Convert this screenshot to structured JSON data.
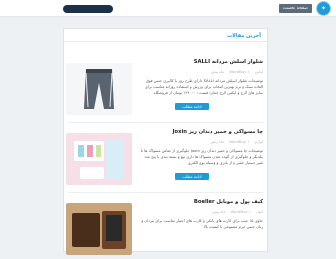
{
  "header": {
    "home_label": "صفحه نخست",
    "colors": {
      "accent": "#1f9bd6",
      "topbar": "#ffffff",
      "search": "#1a3147",
      "button": "#5c6a7a"
    }
  },
  "main": {
    "section_title": "آخرین مقالات",
    "posts": [
      {
        "title": "شلوار اسلش مردانه SALLI",
        "category": "لباس",
        "author": "WordBuy",
        "date": "۱ ماه پیش",
        "excerpt": "توضیحات شلوار اسلش مردانه SALLI دارای طرح روز با کالیری جنس فوق العاده سبک و نرم بهترین انتخاب برای ورزش و استفاده روزانه مناسب برای سایز های لارج و ایکس لارج (مثل)",
        "price": "قیمت : ۱۲۹۰۰۰ تومان از فروشگاه",
        "read_more": "ادامه مطلب"
      },
      {
        "title": "چا مسواکی و خمیر دندان ریز Joxin",
        "category": "لوازم",
        "author": "WordBuy",
        "date": "۱ ماه پیش",
        "excerpt": "توضیحات چا مسواکی و خمیر دندان ریز Joxin جلوگیری از تماس مسواک ها با یکدیگر و جلوگیری از آلوده شدن مسواک ها داری تیغ و بسته بندی با پنج عدد شیر دستیار خمیر و از باتری و وسیله نوع الکتری",
        "price": "",
        "read_more": "ادامه مطلب"
      },
      {
        "title": "کیف پول و موبایل Boeller",
        "category": "کیف",
        "author": "WordBuy",
        "date": "۱ ماه پیش",
        "excerpt": "حاوی ۱۵ جیب برای کارت های بانکی و کارت های اعتبار مناسب برای مردان و زنان جنس چرم مصنوعی با کیفیت بالا",
        "price": "",
        "read_more": "ادامه مطلب"
      }
    ]
  }
}
